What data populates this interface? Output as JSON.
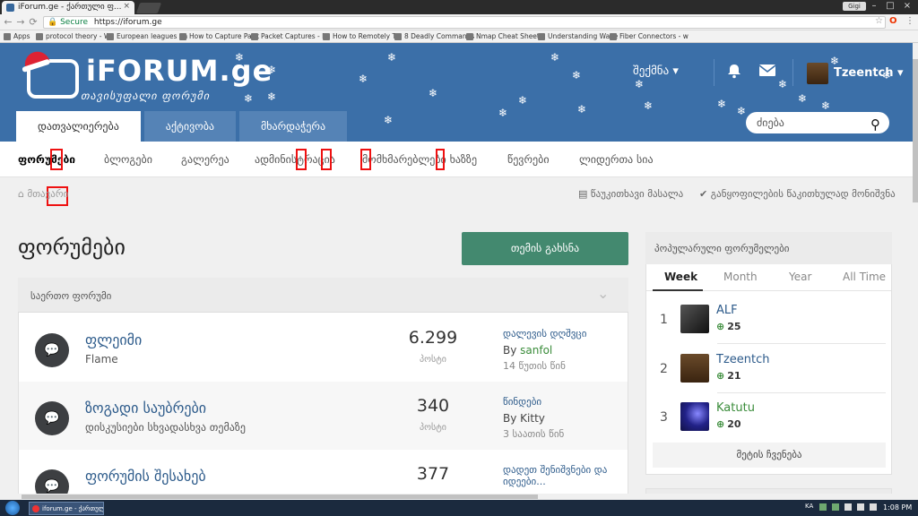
{
  "browser": {
    "tab_title": "iForum.ge - ქართული ფ...",
    "tab_close": "×",
    "user_chip": "Gigi",
    "window_minimize": "–",
    "window_maximize": "□",
    "window_close": "×",
    "back": "←",
    "forward": "→",
    "reload": "⟳",
    "lock": "🔒",
    "secure_label": "Secure",
    "url": "https://iforum.ge",
    "star": "☆",
    "menu": "⋮",
    "bookmarks": [
      "Apps",
      "protocol theory - Wi",
      "European leagues an",
      "How to Capture Pack",
      "Packet Captures - Pa",
      "How to Remotely Tu",
      "8 Deadly Commands",
      "Nmap Cheat Sheet |",
      "Understanding Wave",
      "Fiber Connectors - w"
    ]
  },
  "header": {
    "logo_name": "iFORUM.ge",
    "logo_tagline": "თავისუფალი ფორუმი",
    "create_label": "შექმნა ▾",
    "username": "Tzeentch ▾",
    "search_placeholder": "ძიება",
    "search_icon": "⚲",
    "tabs": [
      "დათვალიერება",
      "აქტივობა",
      "მხარდაჭერა"
    ]
  },
  "subnav": {
    "items": [
      "ფორუმები",
      "ბლოგები",
      "გალერეა",
      "ადმინისტრაცია",
      "მომხმარებლები ხაზზე",
      "წევრები",
      "ლიდერთა სია"
    ]
  },
  "breadcrumb": {
    "home": "მთავარი",
    "unread": "წაუკითხავი მასალა",
    "mark_read": "განყოფილების წაკითხულად მონიშვნა"
  },
  "main": {
    "title": "ფორუმები",
    "new_topic": "თემის გახსნა",
    "category": "საერთო ფორუმი",
    "forums": [
      {
        "title": "ფლეიმი",
        "desc": "Flame",
        "count": "6.299",
        "count_label": "პოსტი",
        "last_topic": "დალევის დღშვცი",
        "by_prefix": "By ",
        "by_user": "sanfol",
        "time": "14 წუთის წინ"
      },
      {
        "title": "ზოგადი საუბრები",
        "desc": "დისკუსიები სხვადასხვა თემაზე",
        "count": "340",
        "count_label": "პოსტი",
        "last_topic": "წინდები",
        "by_prefix": "By ",
        "by_user": "Kitty",
        "time": "3 საათის წინ"
      },
      {
        "title": "ფორუმის შესახებ",
        "desc": "",
        "count": "377",
        "count_label": "",
        "last_topic": "დადეთ შენიშვნები და იდეები...",
        "by_prefix": "",
        "by_user": "",
        "time": ""
      }
    ]
  },
  "sidebar": {
    "title": "პოპულარული ფორუმელები",
    "tabs": [
      "Week",
      "Month",
      "Year",
      "All Time"
    ],
    "leaders": [
      {
        "rank": "1",
        "name": "ALF",
        "score": "25"
      },
      {
        "rank": "2",
        "name": "Tzeentch",
        "score": "21"
      },
      {
        "rank": "3",
        "name": "Katutu",
        "score": "20"
      }
    ],
    "more": "მეტის ჩვენება"
  },
  "taskbar": {
    "app_label": "iforum.ge - ქართული...",
    "lang": "KA",
    "clock": "1:08 PM"
  },
  "colors": {
    "header_blue": "#3b6fa8",
    "new_topic_green": "#43896f",
    "link_blue": "#2c5a8a",
    "user_green": "#3a8c3a",
    "highlight_red": "#ee1111"
  }
}
